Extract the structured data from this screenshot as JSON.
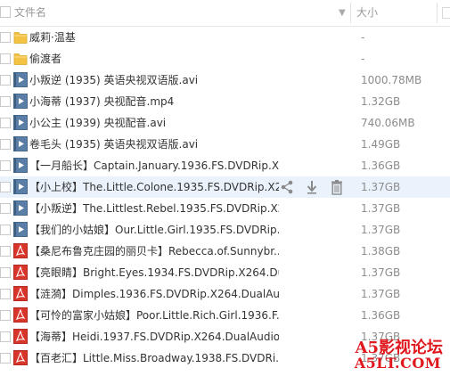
{
  "header": {
    "name_label": "文件名",
    "sort_indicator": "▼",
    "size_label": "大小"
  },
  "colors": {
    "folder": "#f5c344",
    "video": "#5a7ea6",
    "pdf": "#d9362b",
    "hover_row": "#eaf3fc",
    "watermark": "#e0181e"
  },
  "files": [
    {
      "name": "威莉·温基",
      "size": "-",
      "type": "folder"
    },
    {
      "name": "偷渡者",
      "size": "-",
      "type": "folder"
    },
    {
      "name": "小叛逆 (1935) 英语央视双语版.avi",
      "size": "1000.78MB",
      "type": "video"
    },
    {
      "name": "小海蒂 (1937) 央视配音.mp4",
      "size": "1.32GB",
      "type": "video"
    },
    {
      "name": "小公主 (1939) 央视配音.avi",
      "size": "740.06MB",
      "type": "video"
    },
    {
      "name": "卷毛头 (1935) 英语央视双语版.avi",
      "size": "1.49GB",
      "type": "video"
    },
    {
      "name": "【一月船长】Captain.January.1936.FS.DVDRip.X...",
      "size": "1.36GB",
      "type": "video"
    },
    {
      "name": "【小上校】The.Little.Colone.1935.FS.DVDRip.X2...",
      "size": "1.37GB",
      "type": "video",
      "hover": true
    },
    {
      "name": "【小叛逆】The.Littlest.Rebel.1935.FS.DVDRip.X2...",
      "size": "1.37GB",
      "type": "video"
    },
    {
      "name": "【我们的小姑娘】Our.Little.Girl.1935.FS.DVDRip....",
      "size": "1.37GB",
      "type": "video"
    },
    {
      "name": "【桑尼布鲁克庄园的丽贝卡】Rebecca.of.Sunnybr...",
      "size": "1.38GB",
      "type": "pdf"
    },
    {
      "name": "【亮眼睛】Bright.Eyes.1934.FS.DVDRip.X264.Du...",
      "size": "1.37GB",
      "type": "pdf"
    },
    {
      "name": "【涟漪】Dimples.1936.FS.DVDRip.X264.DualAu...",
      "size": "1.37GB",
      "type": "pdf"
    },
    {
      "name": "【可怜的富家小姑娘】Poor.Little.Rich.Girl.1936.F...",
      "size": "1.36GB",
      "type": "pdf"
    },
    {
      "name": "【海蒂】Heidi.1937.FS.DVDRip.X264.DualAudio....",
      "size": "1.37GB",
      "type": "pdf"
    },
    {
      "name": "【百老汇】Little.Miss.Broadway.1938.FS.DVDRi...",
      "size": "1.37GB",
      "type": "pdf"
    }
  ],
  "row_actions": [
    {
      "icon": "share-icon"
    },
    {
      "icon": "download-icon"
    },
    {
      "icon": "trash-icon"
    }
  ],
  "watermark": {
    "line1": "A5影视论坛",
    "line2": "A5LT.COM"
  }
}
